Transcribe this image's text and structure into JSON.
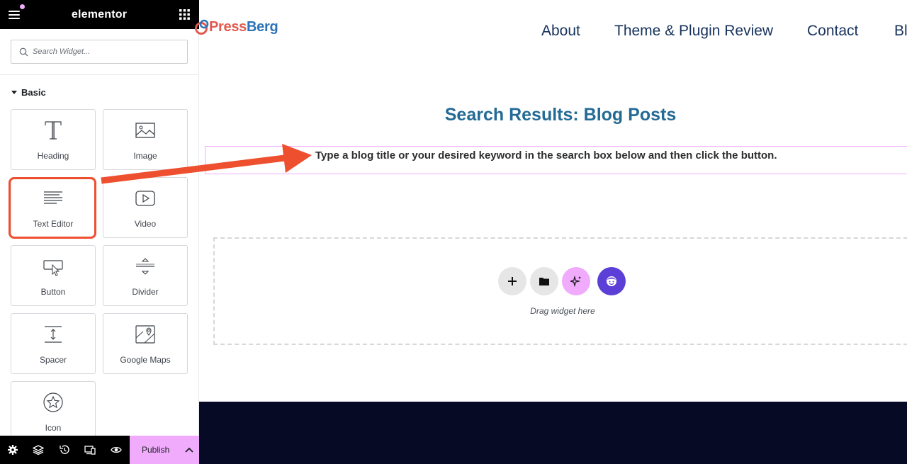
{
  "editor": {
    "brand": "elementor",
    "search": {
      "placeholder": "Search Widget..."
    },
    "section_title": "Basic",
    "widgets": [
      {
        "label": "Heading",
        "icon": "heading-icon"
      },
      {
        "label": "Image",
        "icon": "image-icon"
      },
      {
        "label": "Text Editor",
        "icon": "text-editor-icon"
      },
      {
        "label": "Video",
        "icon": "video-icon"
      },
      {
        "label": "Button",
        "icon": "button-icon"
      },
      {
        "label": "Divider",
        "icon": "divider-icon"
      },
      {
        "label": "Spacer",
        "icon": "spacer-icon"
      },
      {
        "label": "Google Maps",
        "icon": "map-icon"
      },
      {
        "label": "Icon",
        "icon": "star-icon"
      }
    ],
    "bottom_bar": {
      "icons": [
        "settings-icon",
        "layers-icon",
        "history-icon",
        "responsive-icon",
        "preview-icon"
      ],
      "publish_label": "Publish"
    }
  },
  "site": {
    "logo_text_a": "Press",
    "logo_text_b": "Berg",
    "nav": [
      "About",
      "Theme & Plugin Review",
      "Contact",
      "Bl"
    ],
    "heading": "Search Results: Blog Posts",
    "text_widget": "Type a blog title or your desired keyword in the search box below and then click the button.",
    "drop_zone": {
      "buttons": [
        "add-section-icon",
        "templates-folder-icon",
        "ai-sparkle-icon",
        "assistant-icon"
      ],
      "label": "Drag widget here"
    }
  },
  "colors": {
    "accent_pink": "#f0abfc",
    "highlight_orange": "#ee4f2f",
    "heading_blue": "#236a95",
    "nav_navy": "#16325c",
    "footer_dark": "#070a24",
    "assistant_purple": "#5b3fd6"
  }
}
